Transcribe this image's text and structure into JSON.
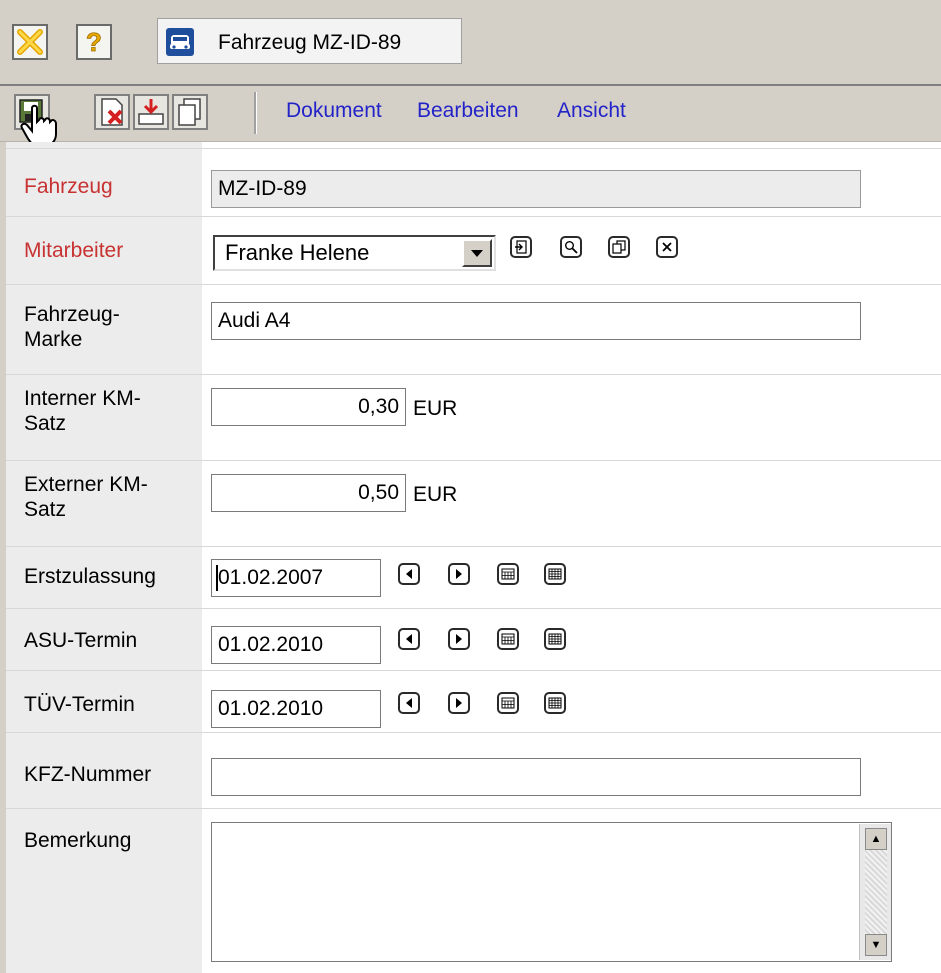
{
  "window": {
    "tab_title": "Fahrzeug MZ-ID-89"
  },
  "titlebar_icons": {
    "close": "close-icon",
    "help": "help-icon",
    "car": "car-icon"
  },
  "menu": {
    "dokument": "Dokument",
    "bearbeiten": "Bearbeiten",
    "ansicht": "Ansicht"
  },
  "form": {
    "fahrzeug": {
      "label": "Fahrzeug",
      "value": "MZ-ID-89"
    },
    "mitarbeiter": {
      "label": "Mitarbeiter",
      "value": "Franke Helene"
    },
    "marke": {
      "label_line1": "Fahrzeug-",
      "label_line2": "Marke",
      "value": "Audi A4"
    },
    "intern": {
      "label_line1": "Interner KM-",
      "label_line2": "Satz",
      "value": "0,30",
      "unit": "EUR"
    },
    "extern": {
      "label_line1": "Externer KM-",
      "label_line2": "Satz",
      "value": "0,50",
      "unit": "EUR"
    },
    "erstzulassung": {
      "label": "Erstzulassung",
      "value": "01.02.2007"
    },
    "asu": {
      "label": "ASU-Termin",
      "value": "01.02.2010"
    },
    "tuev": {
      "label": "TÜV-Termin",
      "value": "01.02.2010"
    },
    "kfz": {
      "label": "KFZ-Nummer",
      "value": ""
    },
    "bemerkung": {
      "label": "Bemerkung",
      "value": ""
    }
  },
  "colors": {
    "required_label": "#c83232",
    "menu_link": "#2323c8",
    "chrome": "#d4d0c8"
  }
}
